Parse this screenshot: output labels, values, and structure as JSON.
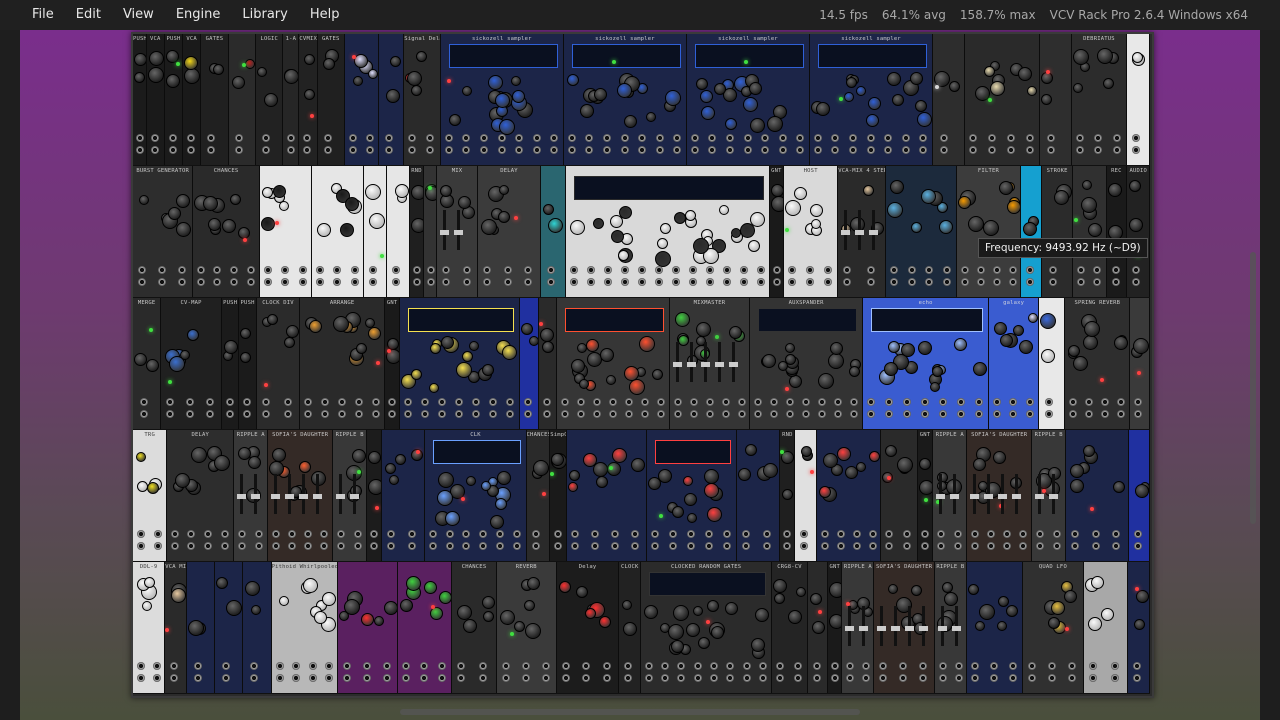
{
  "menu": {
    "file": "File",
    "edit": "Edit",
    "view": "View",
    "engine": "Engine",
    "library": "Library",
    "help": "Help"
  },
  "status": {
    "fps": "14.5 fps",
    "avg": "64.1% avg",
    "max": "158.7% max",
    "app": "VCV Rack Pro 2.6.4 Windows x64"
  },
  "tooltip": "Frequency: 9493.92 Hz (~D9)",
  "rows": [
    [
      {
        "label": "PUSH",
        "w": 12,
        "c": "#1b1b1b"
      },
      {
        "label": "VCA",
        "w": 16,
        "c": "#1a1a1a",
        "accent": "#f1d516"
      },
      {
        "label": "PUSH",
        "w": 16,
        "c": "#1b1b1b"
      },
      {
        "label": "VCA",
        "w": 16,
        "c": "#1a1a1a",
        "accent": "#f1d516"
      },
      {
        "label": "GATES",
        "w": 24,
        "c": "#202020"
      },
      {
        "label": "",
        "w": 24,
        "c": "#2b2b2b",
        "accent": "#c02020"
      },
      {
        "label": "LOGIC",
        "w": 24,
        "c": "#222"
      },
      {
        "label": "1-A",
        "w": 14,
        "c": "#262626"
      },
      {
        "label": "CVMIX",
        "w": 16,
        "c": "#222"
      },
      {
        "label": "GATES",
        "w": 24,
        "c": "#202020"
      },
      {
        "label": "",
        "w": 30,
        "c": "#1c2548",
        "accent": "#e0e0ff"
      },
      {
        "label": "",
        "w": 22,
        "c": "#1c2548"
      },
      {
        "label": "Signal Delay",
        "w": 32,
        "c": "#2a2a2a",
        "accent": "#ff3030"
      },
      {
        "label": "sickozell sampler",
        "w": 108,
        "c": "#1c2548",
        "accent": "#2f60d8"
      },
      {
        "label": "sickozell sampler",
        "w": 108,
        "c": "#1c2548",
        "accent": "#2f60d8"
      },
      {
        "label": "sickozell sampler",
        "w": 108,
        "c": "#1c2548",
        "accent": "#2f60d8"
      },
      {
        "label": "sickozell sampler",
        "w": 108,
        "c": "#1c2548",
        "accent": "#2f60d8"
      },
      {
        "label": "",
        "w": 28,
        "c": "#2d2d2d",
        "accent": "#d8d8d8"
      },
      {
        "label": "",
        "w": 66,
        "c": "#2a2a2a",
        "accent": "#e9dcb0"
      },
      {
        "label": "",
        "w": 28,
        "c": "#2e2e2e"
      },
      {
        "label": "DEBRIATUS",
        "w": 48,
        "c": "#2c2c2c"
      },
      {
        "label": "",
        "w": 20,
        "c": "#e8e8e8"
      }
    ],
    [
      {
        "label": "BURST GENERATOR",
        "w": 58,
        "c": "#2d2d2d"
      },
      {
        "label": "CHANCES",
        "w": 64,
        "c": "#2a2a2a"
      },
      {
        "label": "",
        "w": 50,
        "c": "#e6e6e6",
        "accent": "#1a1a1a"
      },
      {
        "label": "",
        "w": 50,
        "c": "#e6e6e6",
        "accent": "#1a1a1a"
      },
      {
        "label": "",
        "w": 22,
        "c": "#e6e6e6"
      },
      {
        "label": "",
        "w": 22,
        "c": "#e6e6e6"
      },
      {
        "label": "RND",
        "w": 14,
        "c": "#1f1f1f"
      },
      {
        "label": "",
        "w": 12,
        "c": "#333"
      },
      {
        "label": "MIX",
        "w": 40,
        "c": "#3a3a3a"
      },
      {
        "label": "DELAY",
        "w": 60,
        "c": "#3b3b3b"
      },
      {
        "label": "",
        "w": 24,
        "c": "#2a6670",
        "accent": "#2ed5d5"
      },
      {
        "label": "",
        "w": 196,
        "c": "#d9d9d9",
        "accent": "#2a2a2a"
      },
      {
        "label": "GNT",
        "w": 14,
        "c": "#1a1a1a"
      },
      {
        "label": "HOST",
        "w": 52,
        "c": "#d9d9d9"
      },
      {
        "label": "VCA-MIX 4 STEREO",
        "w": 46,
        "c": "#2a2a2a",
        "accent": "#e7c9a0"
      },
      {
        "label": "",
        "w": 68,
        "c": "#1c2a3c",
        "accent": "#5ab0e0"
      },
      {
        "label": "FILTER",
        "w": 62,
        "c": "#3c3c3c",
        "accent": "#f59a00"
      },
      {
        "label": "",
        "w": 20,
        "c": "#15a0d0"
      },
      {
        "label": "STROKE",
        "w": 30,
        "c": "#2b2b2b"
      },
      {
        "label": "",
        "w": 32,
        "c": "#303030"
      },
      {
        "label": "REC",
        "w": 20,
        "c": "#1a1a1a"
      },
      {
        "label": "AUDIO",
        "w": 22,
        "c": "#222"
      }
    ],
    [
      {
        "label": "MERGE",
        "w": 26,
        "c": "#2a2a2a"
      },
      {
        "label": "CV-MAP",
        "w": 56,
        "c": "#202020",
        "accent": "#3a6fd0"
      },
      {
        "label": "PUSH",
        "w": 16,
        "c": "#1b1b1b"
      },
      {
        "label": "PUSH",
        "w": 16,
        "c": "#1b1b1b"
      },
      {
        "label": "CLOCK DIV",
        "w": 40,
        "c": "#2b2b2b"
      },
      {
        "label": "ARRANGE",
        "w": 78,
        "c": "#2a2a2a",
        "accent": "#f0a030"
      },
      {
        "label": "GNT",
        "w": 14,
        "c": "#1a1a1a"
      },
      {
        "label": "",
        "w": 110,
        "c": "#1c2548",
        "accent": "#f5e050"
      },
      {
        "label": "",
        "w": 18,
        "c": "#2030a0"
      },
      {
        "label": "",
        "w": 16,
        "c": "#2a2a2a"
      },
      {
        "label": "",
        "w": 104,
        "c": "#363636",
        "accent": "#ff5030"
      },
      {
        "label": "MIXMASTER",
        "w": 74,
        "c": "#353535",
        "accent": "#40d040"
      },
      {
        "label": "AUXSPANDER",
        "w": 104,
        "c": "#333"
      },
      {
        "label": "echo",
        "w": 116,
        "c": "#3a5cd0",
        "accent": "#a0c0ff"
      },
      {
        "label": "galaxy",
        "w": 46,
        "c": "#3a5cd0",
        "accent": "#e0e0ff"
      },
      {
        "label": "",
        "w": 24,
        "c": "#e8e8e8",
        "accent": "#3a6ae0"
      },
      {
        "label": "SPRING REVERB",
        "w": 60,
        "c": "#2e2e2e"
      },
      {
        "label": "",
        "w": 18,
        "c": "#3a3a3a"
      }
    ],
    [
      {
        "label": "TRG",
        "w": 32,
        "c": "#dcdcdc",
        "accent": "#f0e020"
      },
      {
        "label": "DELAY",
        "w": 62,
        "c": "#2d2d2d"
      },
      {
        "label": "RIPPLE A",
        "w": 32,
        "c": "#383838"
      },
      {
        "label": "SOFIA'S DAUGHTER",
        "w": 60,
        "c": "#342a26",
        "accent": "#ff6030"
      },
      {
        "label": "RIPPLE B",
        "w": 32,
        "c": "#383838"
      },
      {
        "label": "",
        "w": 14,
        "c": "#1c1c1c"
      },
      {
        "label": "",
        "w": 40,
        "c": "#1c2548"
      },
      {
        "label": "CLK",
        "w": 94,
        "c": "#1c2548",
        "accent": "#6aa0ff"
      },
      {
        "label": "CHANCES",
        "w": 22,
        "c": "#2a2a2a"
      },
      {
        "label": "SimpOL",
        "w": 16,
        "c": "#1a1a1a"
      },
      {
        "label": "",
        "w": 74,
        "c": "#1c2548",
        "accent": "#ff4040"
      },
      {
        "label": "",
        "w": 84,
        "c": "#1c2548",
        "accent": "#ff4040"
      },
      {
        "label": "",
        "w": 40,
        "c": "#1c2548"
      },
      {
        "label": "RND",
        "w": 14,
        "c": "#1f1f1f"
      },
      {
        "label": "Trigger Buffer",
        "w": 20,
        "c": "#e0e0e0"
      },
      {
        "label": "",
        "w": 60,
        "c": "#1c2548",
        "accent": "#ff4040"
      },
      {
        "label": "",
        "w": 34,
        "c": "#2a2a2a"
      },
      {
        "label": "GNT",
        "w": 14,
        "c": "#1a1a1a"
      },
      {
        "label": "RIPPLE A",
        "w": 32,
        "c": "#383838"
      },
      {
        "label": "SOFIA'S DAUGHTER",
        "w": 60,
        "c": "#342a26"
      },
      {
        "label": "RIPPLE B",
        "w": 32,
        "c": "#383838"
      },
      {
        "label": "",
        "w": 58,
        "c": "#1c2548"
      },
      {
        "label": "",
        "w": 20,
        "c": "#2030a0"
      }
    ],
    [
      {
        "label": "DDL-9",
        "w": 32,
        "c": "#dcdcdc"
      },
      {
        "label": "VCA MIX 4",
        "w": 22,
        "c": "#2a2a2a",
        "accent": "#e7c9a0"
      },
      {
        "label": "",
        "w": 28,
        "c": "#1c2548"
      },
      {
        "label": "",
        "w": 28,
        "c": "#1c2548"
      },
      {
        "label": "",
        "w": 28,
        "c": "#1c2548"
      },
      {
        "label": "Pithoid Whirlpooled",
        "w": 66,
        "c": "#b8b8b8"
      },
      {
        "label": "",
        "w": 60,
        "c": "#5a2060",
        "accent": "#ff3030"
      },
      {
        "label": "",
        "w": 54,
        "c": "#5a2060",
        "accent": "#40d040"
      },
      {
        "label": "CHANCES",
        "w": 44,
        "c": "#2a2a2a"
      },
      {
        "label": "REVERB",
        "w": 60,
        "c": "#3a3a3a"
      },
      {
        "label": "Delay",
        "w": 62,
        "c": "#1c1c1c",
        "accent": "#ff3030"
      },
      {
        "label": "CLOCK",
        "w": 22,
        "c": "#222"
      },
      {
        "label": "CLOCKED RANDOM GATES",
        "w": 130,
        "c": "#2b2b2b"
      },
      {
        "label": "CRG8-CV",
        "w": 36,
        "c": "#242424"
      },
      {
        "label": "",
        "w": 20,
        "c": "#2a2a2a"
      },
      {
        "label": "GNT",
        "w": 14,
        "c": "#1a1a1a"
      },
      {
        "label": "RIPPLE A",
        "w": 32,
        "c": "#383838"
      },
      {
        "label": "SOFIA'S DAUGHTER",
        "w": 60,
        "c": "#342a26"
      },
      {
        "label": "RIPPLE B",
        "w": 32,
        "c": "#383838"
      },
      {
        "label": "",
        "w": 56,
        "c": "#1c2548"
      },
      {
        "label": "QUAD LFO",
        "w": 60,
        "c": "#303030",
        "accent": "#e8c040"
      },
      {
        "label": "",
        "w": 44,
        "c": "#a8a8a8"
      },
      {
        "label": "",
        "w": 22,
        "c": "#1c2548"
      }
    ]
  ]
}
